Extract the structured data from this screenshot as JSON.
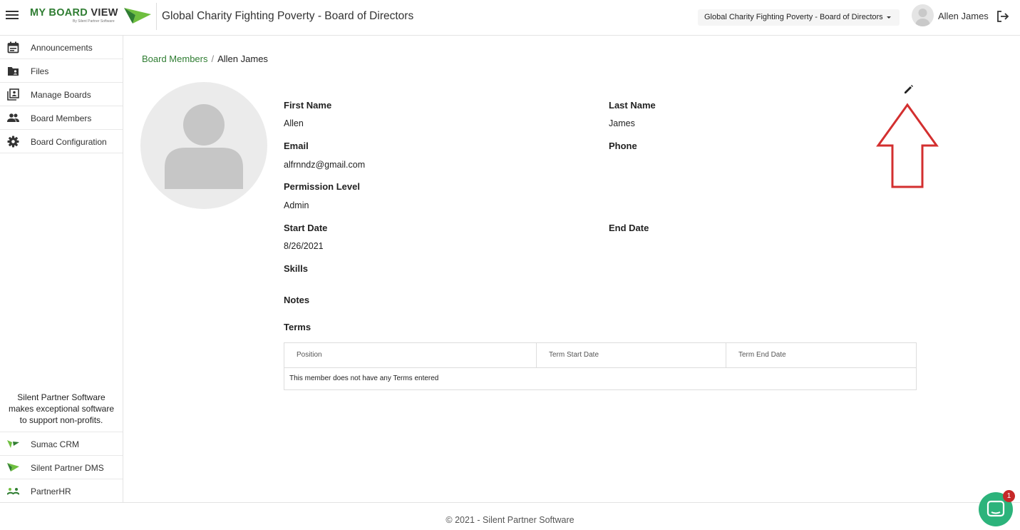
{
  "header": {
    "logo_my": "MY BOARD",
    "logo_view": " VIEW",
    "logo_sub": "By Silent Partner Software",
    "board_title": "Global Charity Fighting Poverty - Board of Directors",
    "board_select": "Global Charity Fighting Poverty - Board of Directors",
    "user_name": "Allen James"
  },
  "sidebar": {
    "items": [
      {
        "label": "Announcements",
        "icon": "calendar-icon"
      },
      {
        "label": "Files",
        "icon": "folder-icon"
      },
      {
        "label": "Manage Boards",
        "icon": "board-book-icon"
      },
      {
        "label": "Board Members",
        "icon": "people-icon"
      },
      {
        "label": "Board Configuration",
        "icon": "gear-icon"
      }
    ],
    "note": "Silent Partner Software makes exceptional software to support non-profits.",
    "products": [
      {
        "label": "Sumac CRM",
        "icon": "sumac-logo-icon"
      },
      {
        "label": "Silent Partner DMS",
        "icon": "spdms-logo-icon"
      },
      {
        "label": "PartnerHR",
        "icon": "partnerhr-logo-icon"
      }
    ]
  },
  "breadcrumb": {
    "parent": "Board Members",
    "separator": "/",
    "current": "Allen James"
  },
  "profile": {
    "first_name_label": "First Name",
    "first_name": "Allen",
    "last_name_label": "Last Name",
    "last_name": "James",
    "email_label": "Email",
    "email": "alfrnndz@gmail.com",
    "phone_label": "Phone",
    "phone": "",
    "permission_label": "Permission Level",
    "permission": "Admin",
    "start_date_label": "Start Date",
    "start_date": "8/26/2021",
    "end_date_label": "End Date",
    "end_date": "",
    "skills_label": "Skills",
    "notes_label": "Notes",
    "terms_label": "Terms"
  },
  "terms_table": {
    "columns": [
      "Position",
      "Term Start Date",
      "Term End Date"
    ],
    "empty_message": "This member does not have any Terms entered"
  },
  "footer": {
    "text": "© 2021 - Silent Partner Software"
  },
  "chat": {
    "badge": "1"
  },
  "colors": {
    "brand_green": "#2f7d32",
    "annotation_red": "#d32f2f",
    "chat_green": "#2cb37b"
  }
}
